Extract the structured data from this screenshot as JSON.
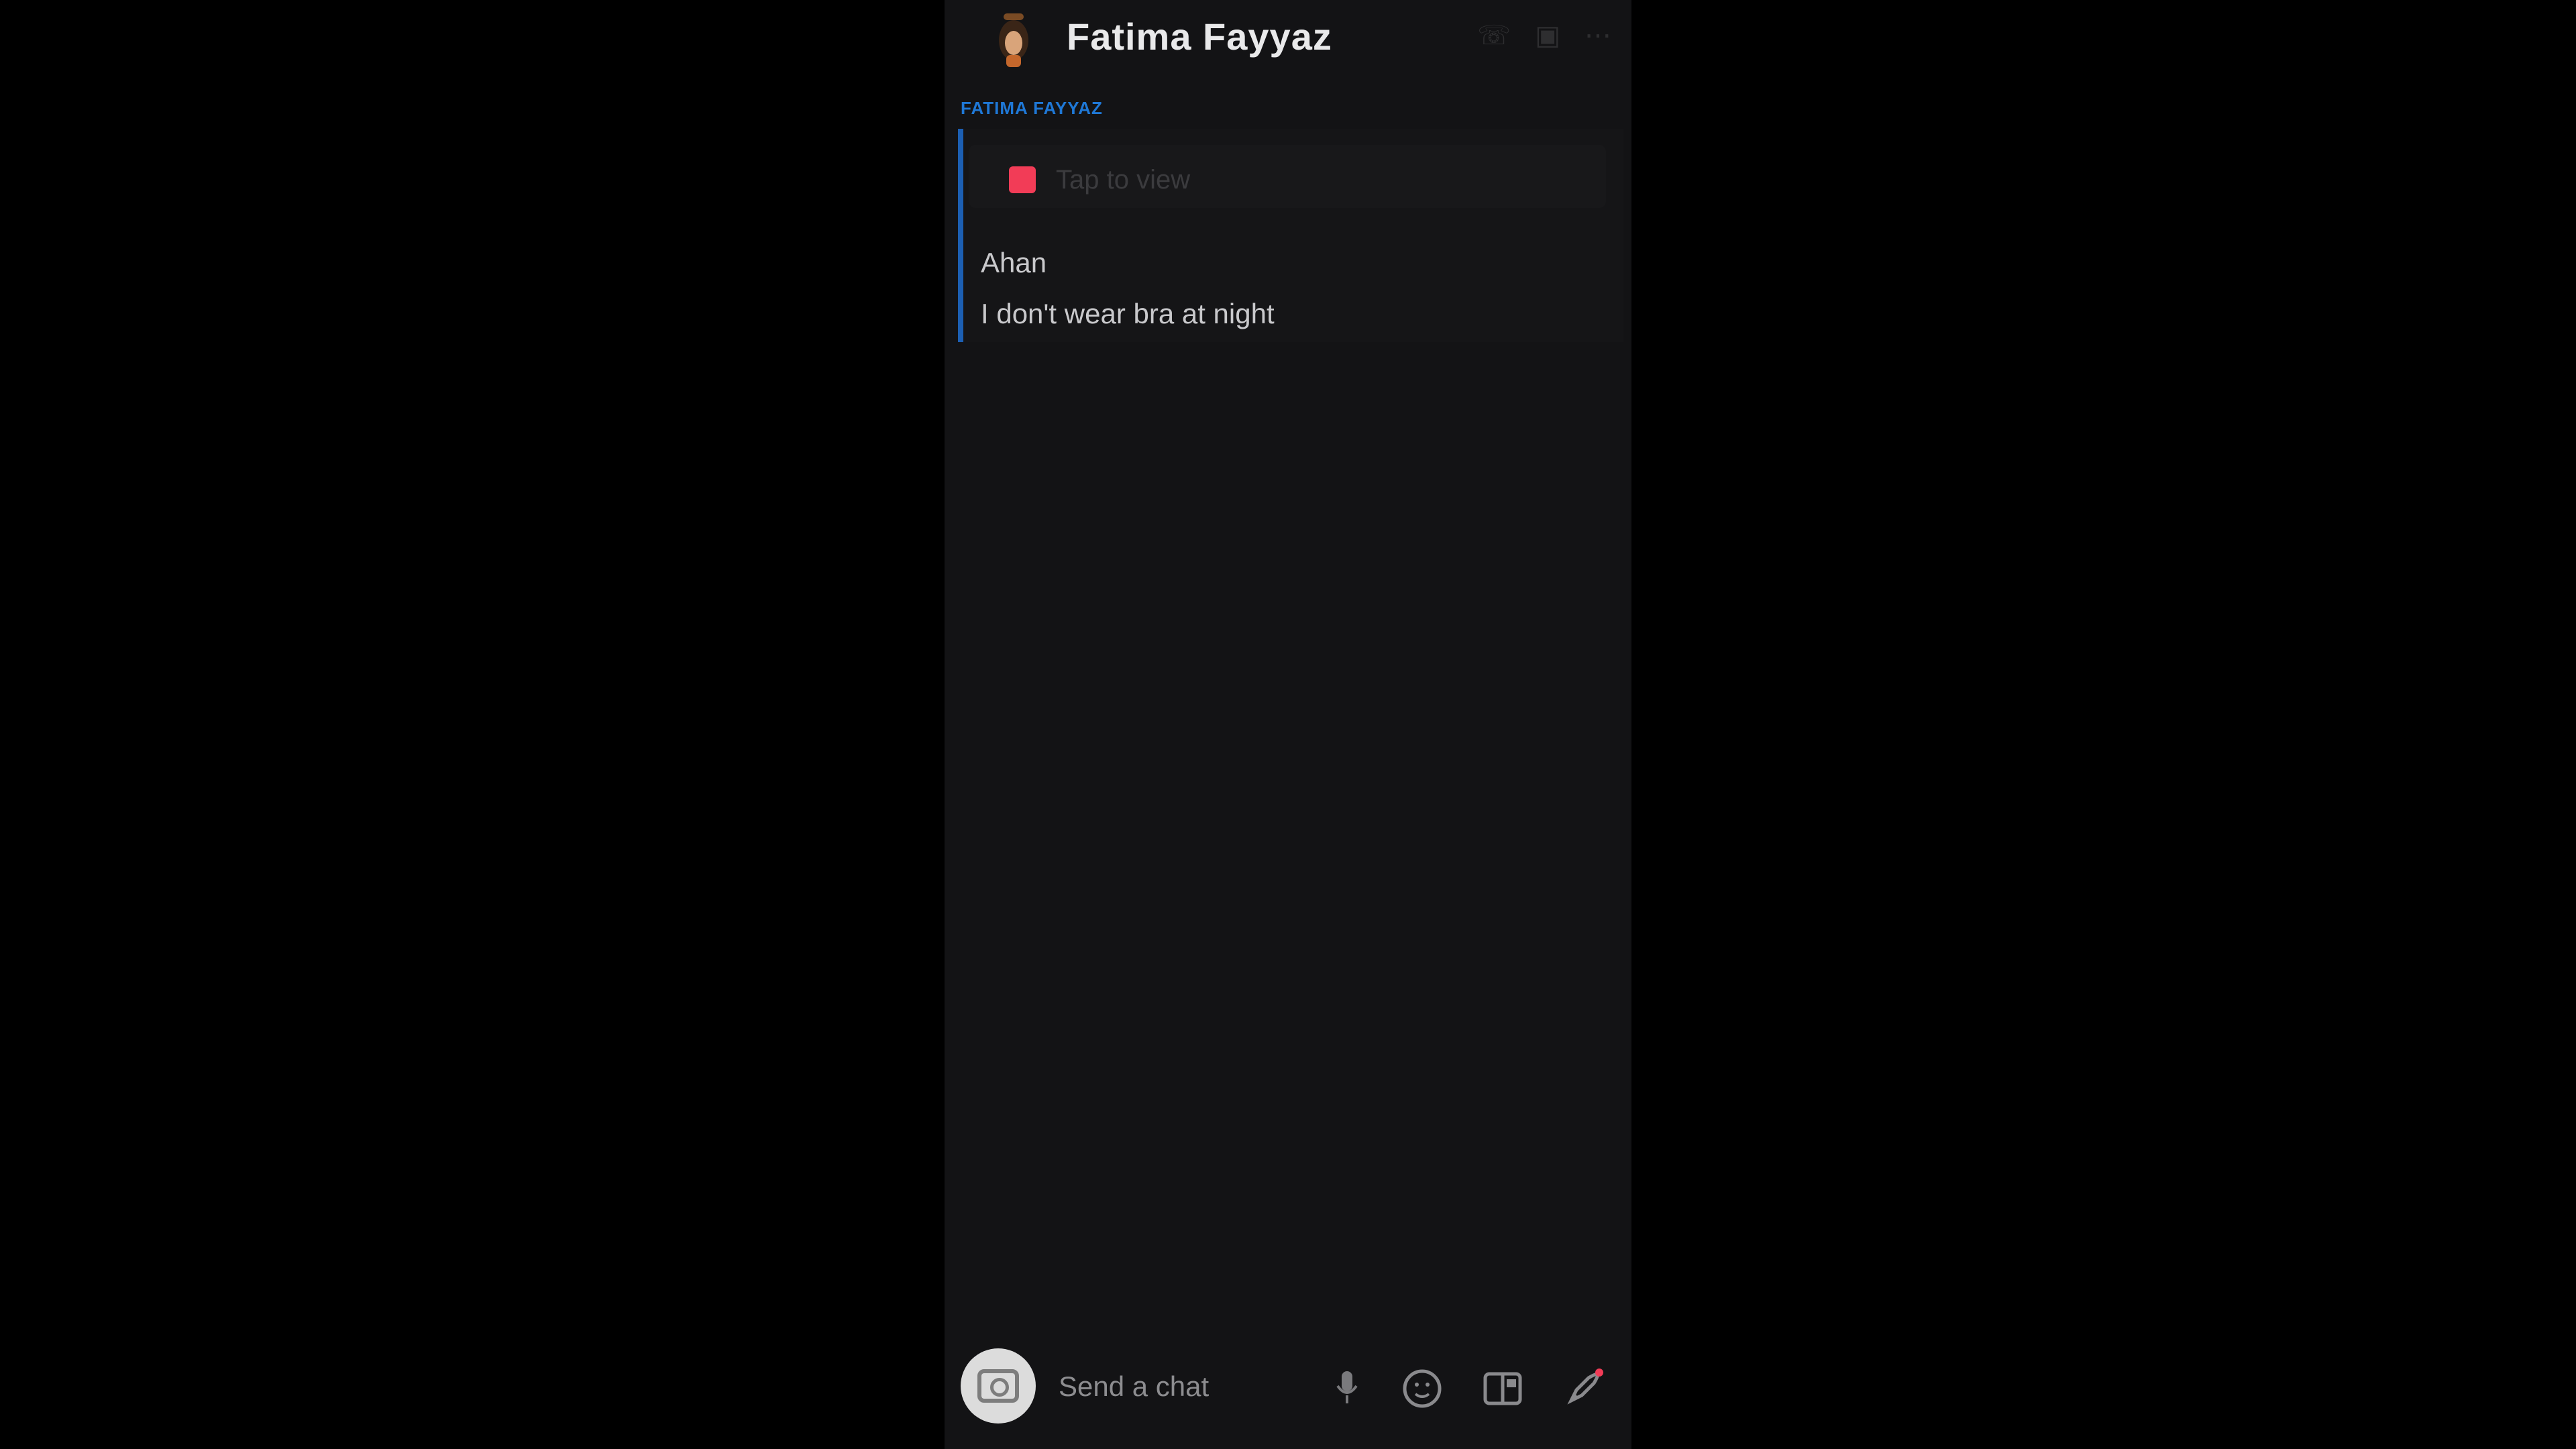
{
  "header": {
    "contact_name": "Fatima Fayyaz"
  },
  "conversation": {
    "sender_label": "FATIMA FAYYAZ",
    "snap": {
      "label": "Tap to view",
      "color": "#f23c57"
    },
    "messages": [
      {
        "text": "Ahan"
      },
      {
        "text": "I don't wear bra at night"
      }
    ],
    "accent_color": "#1c5fb3"
  },
  "composer": {
    "placeholder": "Send a chat"
  },
  "icons": {
    "camera": "camera-icon",
    "mic": "microphone-icon",
    "emoji": "emoji-icon",
    "stickers": "sticker-icon",
    "rocket": "rocket-icon"
  }
}
